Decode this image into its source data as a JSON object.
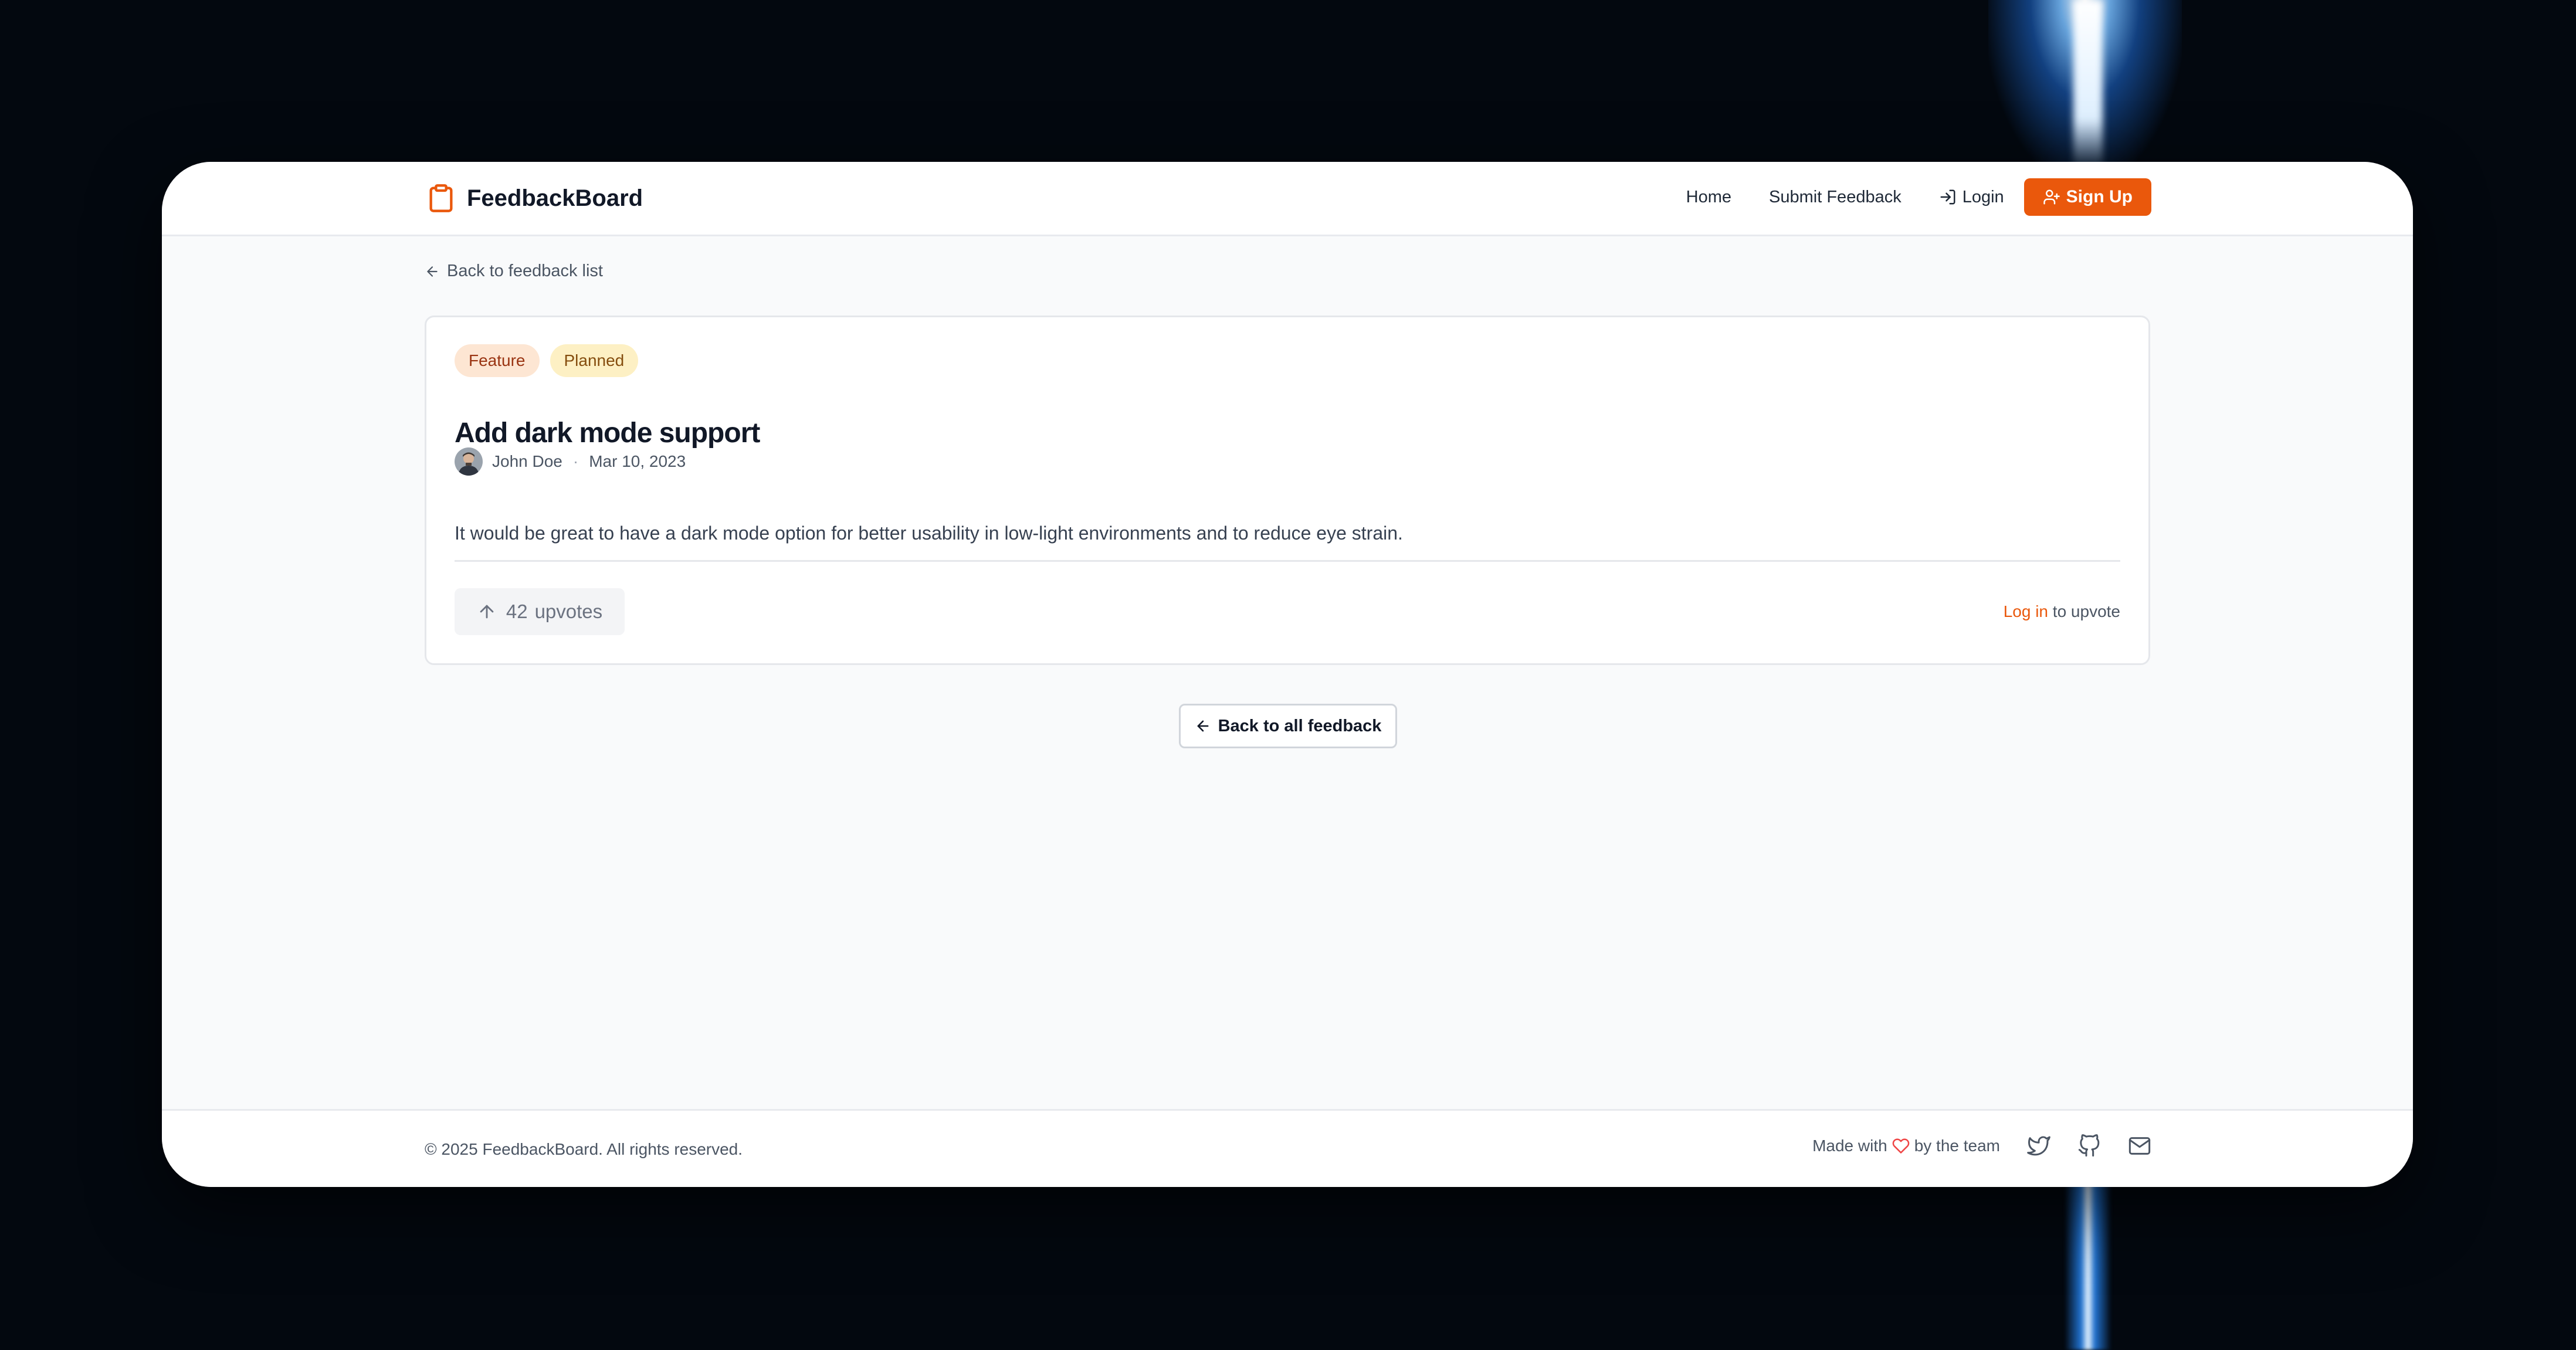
{
  "brand": {
    "name": "FeedbackBoard",
    "icon": "clipboard-icon",
    "accent": "#ea580c"
  },
  "nav": {
    "home": "Home",
    "submit": "Submit Feedback",
    "login": "Login",
    "signup": "Sign Up"
  },
  "back_link": "Back to feedback list",
  "feedback": {
    "category": "Feature",
    "status": "Planned",
    "title": "Add dark mode support",
    "author": "John Doe",
    "separator": "·",
    "date": "Mar 10, 2023",
    "description": "It would be great to have a dark mode option for better usability in low-light environments and to reduce eye strain.",
    "upvote_count": "42",
    "upvote_label": "upvotes",
    "login_link": "Log in",
    "login_suffix": "to upvote"
  },
  "back_all": "Back to all feedback",
  "footer": {
    "copyright": "© 2025 FeedbackBoard. All rights reserved.",
    "made_with": "Made with",
    "by_team": "by the team",
    "icons": [
      "twitter-icon",
      "github-icon",
      "mail-icon"
    ]
  }
}
